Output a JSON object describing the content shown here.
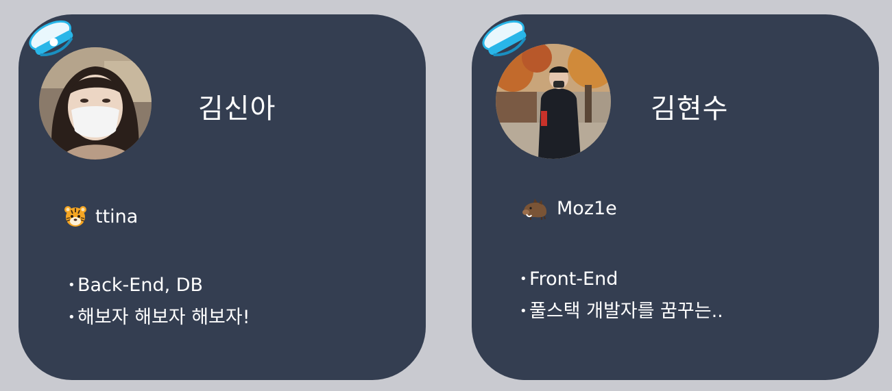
{
  "cards": [
    {
      "name": "김신아",
      "handle": "ttina",
      "handle_icon": "tiger-face-icon",
      "bullets": [
        "Back-End, DB",
        "해보자 해보자 해보자!"
      ]
    },
    {
      "name": "김현수",
      "handle": "Moz1e",
      "handle_icon": "boar-icon",
      "bullets": [
        "Front-End",
        "풀스택 개발자를 꿈꾸는.."
      ]
    }
  ],
  "colors": {
    "background": "#c9cad0",
    "card": "#343e51",
    "text": "#ffffff",
    "hat_accent": "#29b6e8"
  }
}
